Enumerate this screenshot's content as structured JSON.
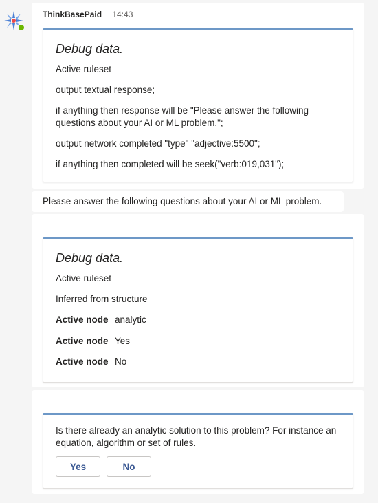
{
  "bot": {
    "name": "ThinkBasePaid",
    "time": "14:43",
    "avatar_icon": "bot-avatar-icon",
    "status_color": "#6bb700"
  },
  "card1": {
    "title": "Debug data.",
    "lines": [
      "Active ruleset",
      "output textual response;",
      "if anything then response will be \"Please answer the following questions about your AI or ML problem.\";",
      "output network completed \"type\" \"adjective:5500\";",
      "if anything then completed will be seek(\"verb:019,031\");"
    ]
  },
  "message2": {
    "text": "Please answer the following questions about your AI or ML problem."
  },
  "card3": {
    "title": "Debug data.",
    "lines": [
      "Active ruleset",
      "Inferred from structure"
    ],
    "facts": [
      {
        "key": "Active node",
        "value": "analytic"
      },
      {
        "key": "Active node",
        "value": "Yes"
      },
      {
        "key": "Active node",
        "value": "No"
      }
    ]
  },
  "card4": {
    "question": "Is there already an analytic solution to this problem? For instance an equation, algorithm or set of rules.",
    "yes_label": "Yes",
    "no_label": "No"
  },
  "colors": {
    "accent": "#6d98c7",
    "button_text": "#3c5a94"
  }
}
